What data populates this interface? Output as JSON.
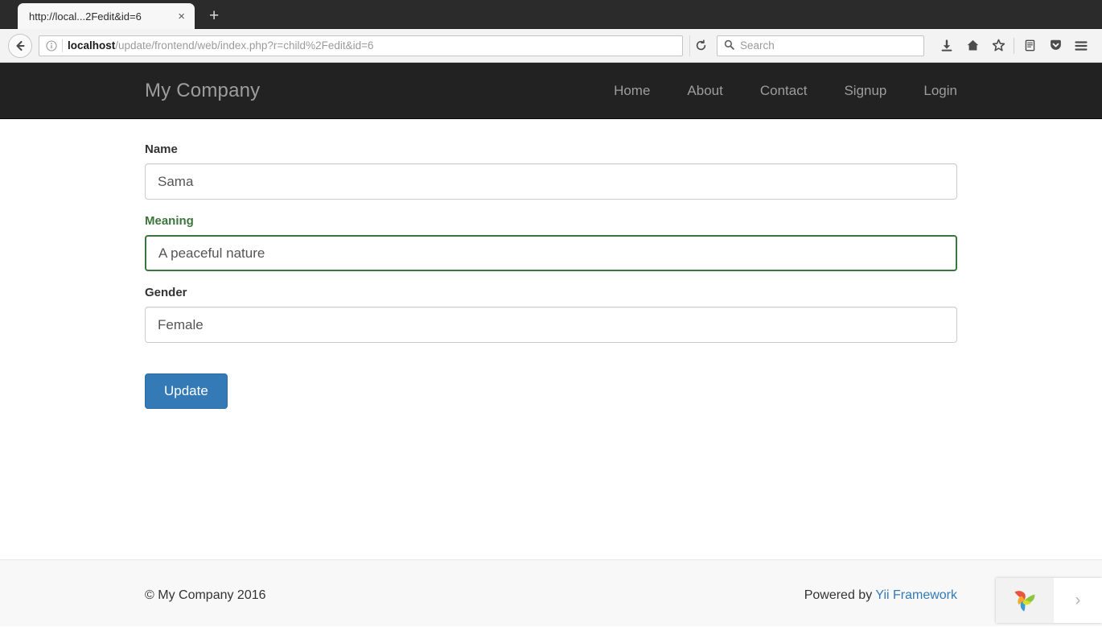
{
  "browser": {
    "tab": {
      "title": "http://local...2Fedit&id=6",
      "close_label": "×"
    },
    "new_tab_label": "+",
    "back_icon": "back-arrow-icon",
    "identity_icon": "info-icon",
    "url": {
      "host": "localhost",
      "path": "/update/frontend/web/index.php?r=child%2Fedit&id=6",
      "full": "localhost/update/frontend/web/index.php?r=child%2Fedit&id=6"
    },
    "reload_label": "⟳",
    "search": {
      "placeholder": "Search",
      "value": ""
    },
    "toolbar_icons": [
      {
        "name": "downloads-icon",
        "glyph": "⬇"
      },
      {
        "name": "home-icon",
        "glyph": "⌂"
      },
      {
        "name": "bookmark-star-icon",
        "glyph": "☆"
      },
      {
        "name": "library-icon",
        "glyph": "▤"
      },
      {
        "name": "pocket-icon",
        "glyph": "▼"
      },
      {
        "name": "menu-hamburger-icon",
        "glyph": "≡"
      }
    ]
  },
  "site": {
    "brand": "My Company",
    "nav": [
      {
        "label": "Home"
      },
      {
        "label": "About"
      },
      {
        "label": "Contact"
      },
      {
        "label": "Signup"
      },
      {
        "label": "Login"
      }
    ]
  },
  "form": {
    "fields": [
      {
        "label": "Name",
        "value": "Sama",
        "state": "default"
      },
      {
        "label": "Meaning",
        "value": "A peaceful nature",
        "state": "success"
      },
      {
        "label": "Gender",
        "value": "Female",
        "state": "default"
      }
    ],
    "submit_label": "Update"
  },
  "footer": {
    "copyright": "© My Company 2016",
    "powered_by_prefix": "Powered by ",
    "powered_by_link": "Yii Framework"
  },
  "corner_widget": {
    "logo_icon": "pinwheel-leaf-logo-icon",
    "expand_icon": "chevron-right-icon",
    "expand_glyph": "›"
  },
  "colors": {
    "navbar_bg": "#222222",
    "navbar_text": "#9d9d9d",
    "page_bg": "#ffffff",
    "label_default": "#333333",
    "label_success": "#3c763d",
    "input_border": "#cccccc",
    "input_border_success": "#3c763d",
    "primary_button_bg": "#337ab7",
    "primary_button_border": "#2e6da4",
    "link_blue": "#337ab7",
    "footer_bg": "#f8f8f8",
    "chrome_bg": "#2b2b2b",
    "toolbar_bg": "#f3f3f3"
  }
}
